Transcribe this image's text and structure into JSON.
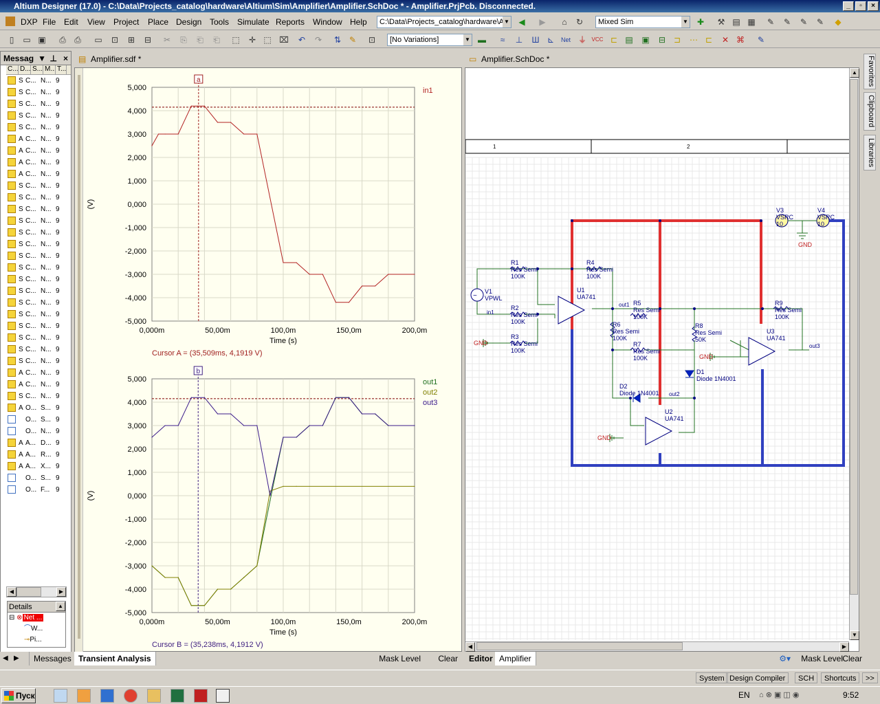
{
  "window": {
    "title": "Altium Designer (17.0) - C:\\Data\\Projects_catalog\\hardware\\Altium\\Sim\\Amplifier\\Amplifier.SchDoc * - Amplifier.PrjPcb. Disconnected."
  },
  "menu": [
    "DXP",
    "File",
    "Edit",
    "View",
    "Project",
    "Place",
    "Design",
    "Tools",
    "Simulate",
    "Reports",
    "Window",
    "Help"
  ],
  "path_combo": "C:\\Data\\Projects_catalog\\hardware\\A",
  "sim_combo": "Mixed Sim",
  "variations_combo": "[No Variations]",
  "messages_panel": {
    "title": "Messag",
    "cols": [
      "C...",
      "D...",
      "S...",
      "M...",
      "T..."
    ],
    "rows": [
      {
        "a": "S",
        "b": "C...",
        "c": "N...",
        "d": "9"
      },
      {
        "a": "S",
        "b": "C...",
        "c": "N...",
        "d": "9"
      },
      {
        "a": "S",
        "b": "C...",
        "c": "N...",
        "d": "9"
      },
      {
        "a": "S",
        "b": "C...",
        "c": "N...",
        "d": "9"
      },
      {
        "a": "S",
        "b": "C...",
        "c": "N...",
        "d": "9"
      },
      {
        "a": "A",
        "b": "C...",
        "c": "N...",
        "d": "9"
      },
      {
        "a": "A",
        "b": "C...",
        "c": "N...",
        "d": "9"
      },
      {
        "a": "A",
        "b": "C...",
        "c": "N...",
        "d": "9"
      },
      {
        "a": "A",
        "b": "C...",
        "c": "N...",
        "d": "9"
      },
      {
        "a": "S",
        "b": "C...",
        "c": "N...",
        "d": "9"
      },
      {
        "a": "S",
        "b": "C...",
        "c": "N...",
        "d": "9"
      },
      {
        "a": "S",
        "b": "C...",
        "c": "N...",
        "d": "9"
      },
      {
        "a": "S",
        "b": "C...",
        "c": "N...",
        "d": "9"
      },
      {
        "a": "S",
        "b": "C...",
        "c": "N...",
        "d": "9"
      },
      {
        "a": "S",
        "b": "C...",
        "c": "N...",
        "d": "9"
      },
      {
        "a": "S",
        "b": "C...",
        "c": "N...",
        "d": "9"
      },
      {
        "a": "S",
        "b": "C...",
        "c": "N...",
        "d": "9"
      },
      {
        "a": "S",
        "b": "C...",
        "c": "N...",
        "d": "9"
      },
      {
        "a": "S",
        "b": "C...",
        "c": "N...",
        "d": "9"
      },
      {
        "a": "S",
        "b": "C...",
        "c": "N...",
        "d": "9"
      },
      {
        "a": "S",
        "b": "C...",
        "c": "N...",
        "d": "9"
      },
      {
        "a": "S",
        "b": "C...",
        "c": "N...",
        "d": "9"
      },
      {
        "a": "S",
        "b": "C...",
        "c": "N...",
        "d": "9"
      },
      {
        "a": "S",
        "b": "C...",
        "c": "N...",
        "d": "9"
      },
      {
        "a": "S",
        "b": "C...",
        "c": "N...",
        "d": "9"
      },
      {
        "a": "A",
        "b": "C...",
        "c": "N...",
        "d": "9"
      },
      {
        "a": "A",
        "b": "C...",
        "c": "N...",
        "d": "9"
      },
      {
        "a": "S",
        "b": "C...",
        "c": "N...",
        "d": "9"
      },
      {
        "a": "A",
        "b": "O...",
        "c": "S...",
        "d": "9"
      },
      {
        "a": "",
        "b": "O...",
        "c": "S...",
        "d": "9",
        "fold": true
      },
      {
        "a": "",
        "b": "O...",
        "c": "N...",
        "d": "9",
        "fold": true
      },
      {
        "a": "A",
        "b": "A...",
        "c": "D...",
        "d": "9"
      },
      {
        "a": "A",
        "b": "A...",
        "c": "R...",
        "d": "9"
      },
      {
        "a": "A",
        "b": "A...",
        "c": "X...",
        "d": "9"
      },
      {
        "a": "",
        "b": "O...",
        "c": "S...",
        "d": "9",
        "fold": true
      },
      {
        "a": "",
        "b": "O...",
        "c": "F...",
        "d": "9",
        "fold": true
      }
    ]
  },
  "details_panel": {
    "title": "Details",
    "item1": "Net ...",
    "item2": "W...",
    "item3": "Pi..."
  },
  "left_tabs": {
    "messages": "Messages"
  },
  "sim_doc": {
    "tab": "Amplifier.sdf *",
    "bottom_tab": "Transient Analysis",
    "mask_level": "Mask Level",
    "clear": "Clear"
  },
  "sch_doc": {
    "tab": "Amplifier.SchDoc *",
    "tab_editor": "Editor",
    "tab_amplifier": "Amplifier",
    "mask_level": "Mask Level",
    "clear": "Clear"
  },
  "right_dock": [
    "Favorites",
    "Clipboard",
    "Libraries"
  ],
  "chart_data": [
    {
      "type": "line",
      "xlabel": "Time (s)",
      "ylabel": "(V)",
      "xlim": [
        0,
        0.2
      ],
      "ylim": [
        -5000,
        5000
      ],
      "x_ticks": [
        "0,000m",
        "50,00m",
        "100,0m",
        "150,0m",
        "200,0m"
      ],
      "y_ticks": [
        "5,000",
        "4,000",
        "3,000",
        "2,000",
        "1,000",
        "0,000",
        "-1,000",
        "-2,000",
        "-3,000",
        "-4,000",
        "-5,000"
      ],
      "series": [
        {
          "name": "in1",
          "color": "#b22222",
          "x": [
            0,
            0.005,
            0.01,
            0.02,
            0.03,
            0.035,
            0.04,
            0.05,
            0.06,
            0.07,
            0.08,
            0.1,
            0.11,
            0.12,
            0.13,
            0.14,
            0.15,
            0.16,
            0.17,
            0.18,
            0.2
          ],
          "y": [
            2500,
            3000,
            3000,
            3000,
            4200,
            4200,
            4200,
            3500,
            3500,
            3000,
            3000,
            -2500,
            -2500,
            -3000,
            -3000,
            -4200,
            -4200,
            -3500,
            -3500,
            -3000,
            -3000
          ]
        }
      ],
      "cursor": {
        "label": "a",
        "x": 0.0355,
        "text": "Cursor A = (35,509ms, 4,1919 V)"
      },
      "hline": 4150
    },
    {
      "type": "line",
      "xlabel": "Time (s)",
      "ylabel": "(V)",
      "xlim": [
        0,
        0.2
      ],
      "ylim": [
        -5000,
        5000
      ],
      "x_ticks": [
        "0,000m",
        "50,00m",
        "100,0m",
        "150,0m",
        "200,0m"
      ],
      "y_ticks": [
        "5,000",
        "4,000",
        "3,000",
        "2,000",
        "1,000",
        "0,000",
        "-1,000",
        "-2,000",
        "-3,000",
        "-4,000",
        "-5,000"
      ],
      "series": [
        {
          "name": "out1",
          "color": "#207020",
          "x": [
            0,
            0.01,
            0.02,
            0.03,
            0.04,
            0.05,
            0.06,
            0.07,
            0.08,
            0.09,
            0.1,
            0.11,
            0.12,
            0.13,
            0.14,
            0.15,
            0.16,
            0.17,
            0.18,
            0.2
          ],
          "y": [
            -3000,
            -3500,
            -3500,
            -4700,
            -4700,
            -4000,
            -4000,
            -3500,
            -3000,
            -200,
            2500,
            2500,
            3000,
            3000,
            4200,
            4200,
            3500,
            3500,
            3000,
            3000
          ]
        },
        {
          "name": "out2",
          "color": "#808000",
          "x": [
            0,
            0.01,
            0.02,
            0.03,
            0.04,
            0.05,
            0.06,
            0.07,
            0.08,
            0.09,
            0.1,
            0.11,
            0.2
          ],
          "y": [
            -3000,
            -3500,
            -3500,
            -4700,
            -4700,
            -4000,
            -4000,
            -3500,
            -3000,
            200,
            400,
            400,
            400
          ]
        },
        {
          "name": "out3",
          "color": "#3a1a8a",
          "x": [
            0,
            0.01,
            0.02,
            0.03,
            0.04,
            0.05,
            0.06,
            0.07,
            0.08,
            0.09,
            0.1,
            0.11,
            0.12,
            0.13,
            0.14,
            0.15,
            0.16,
            0.17,
            0.18,
            0.2
          ],
          "y": [
            2500,
            3000,
            3000,
            4200,
            4200,
            3500,
            3500,
            3000,
            3000,
            0,
            2500,
            2500,
            3000,
            3000,
            4200,
            4200,
            3500,
            3500,
            3000,
            3000
          ]
        }
      ],
      "cursor": {
        "label": "b",
        "x": 0.0352,
        "text": "Cursor B = (35,238ms, 4,1912 V)"
      },
      "hline": 4150
    }
  ],
  "schematic": {
    "zones": [
      "1",
      "2"
    ],
    "parts": [
      {
        "ref": "V1",
        "val": "VPWL"
      },
      {
        "ref": "R1",
        "val": "Res Semi",
        "v2": "100K"
      },
      {
        "ref": "R2",
        "val": "Res Semi",
        "v2": "100K"
      },
      {
        "ref": "R3",
        "val": "Res Semi",
        "v2": "100K"
      },
      {
        "ref": "R4",
        "val": "Res Semi",
        "v2": "100K"
      },
      {
        "ref": "U1",
        "val": "UA741"
      },
      {
        "ref": "R5",
        "val": "Res Semi",
        "v2": "100K"
      },
      {
        "ref": "R6",
        "val": "Res Semi",
        "v2": "100K"
      },
      {
        "ref": "R7",
        "val": "Res Semi",
        "v2": "100K"
      },
      {
        "ref": "R8",
        "val": "Res Semi",
        "v2": "50K"
      },
      {
        "ref": "R9",
        "val": "Res Semi",
        "v2": "100K"
      },
      {
        "ref": "U3",
        "val": "UA741"
      },
      {
        "ref": "D1",
        "val": "Diode 1N4001"
      },
      {
        "ref": "D2",
        "val": "Diode 1N4001"
      },
      {
        "ref": "U2",
        "val": "UA741"
      },
      {
        "ref": "V3",
        "val": "VSRC",
        "v2": "10"
      },
      {
        "ref": "V4",
        "val": "VSRC",
        "v2": "10"
      }
    ],
    "nets": [
      "in1",
      "out1",
      "out2",
      "out3",
      "GND"
    ]
  },
  "status": {
    "system": "System",
    "design_compiler": "Design Compiler",
    "sch": "SCH",
    "shortcuts": "Shortcuts"
  },
  "taskbar": {
    "start": "Пуск",
    "lang": "EN",
    "clock": "9:52"
  }
}
